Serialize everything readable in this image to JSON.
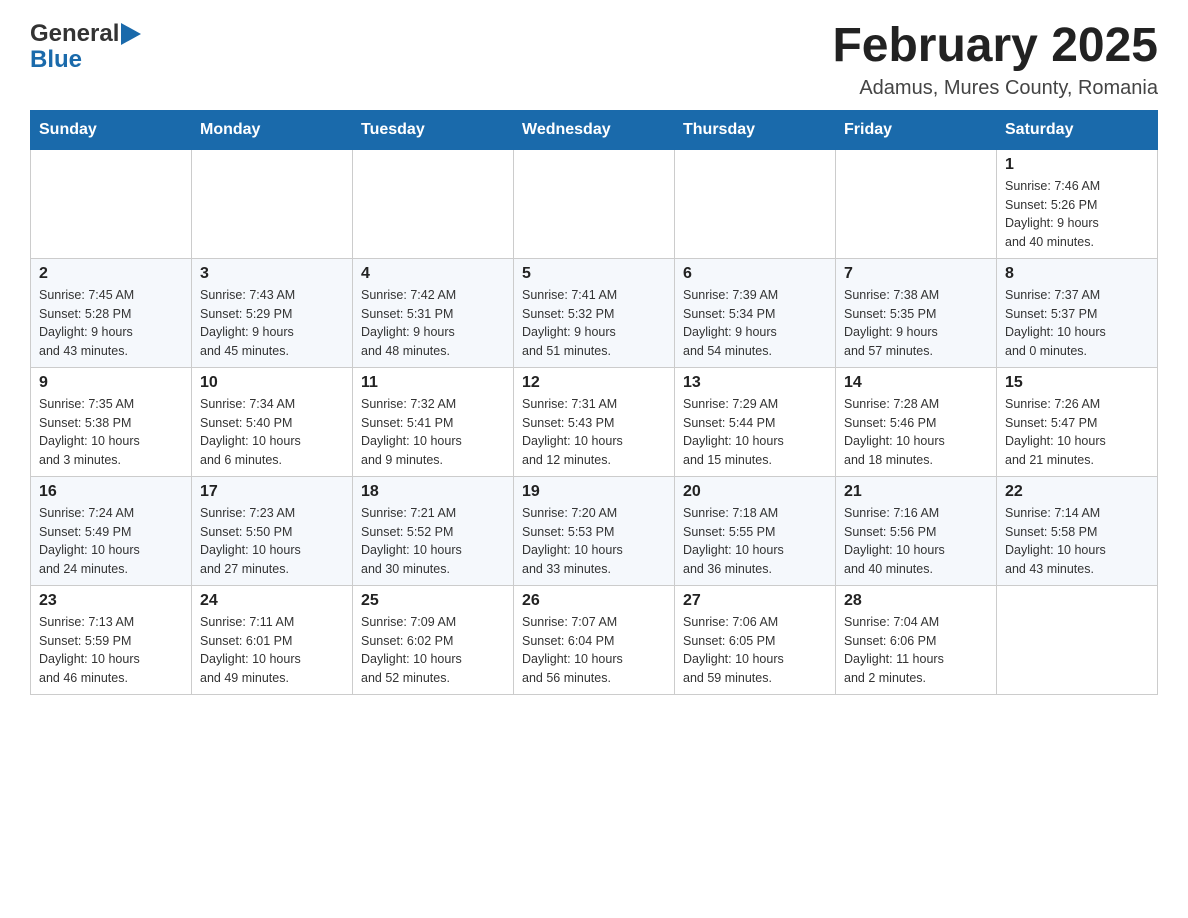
{
  "header": {
    "title": "February 2025",
    "subtitle": "Adamus, Mures County, Romania"
  },
  "logo": {
    "general": "General",
    "blue": "Blue"
  },
  "weekdays": [
    "Sunday",
    "Monday",
    "Tuesday",
    "Wednesday",
    "Thursday",
    "Friday",
    "Saturday"
  ],
  "weeks": [
    {
      "days": [
        {
          "number": "",
          "info": ""
        },
        {
          "number": "",
          "info": ""
        },
        {
          "number": "",
          "info": ""
        },
        {
          "number": "",
          "info": ""
        },
        {
          "number": "",
          "info": ""
        },
        {
          "number": "",
          "info": ""
        },
        {
          "number": "1",
          "info": "Sunrise: 7:46 AM\nSunset: 5:26 PM\nDaylight: 9 hours\nand 40 minutes."
        }
      ]
    },
    {
      "days": [
        {
          "number": "2",
          "info": "Sunrise: 7:45 AM\nSunset: 5:28 PM\nDaylight: 9 hours\nand 43 minutes."
        },
        {
          "number": "3",
          "info": "Sunrise: 7:43 AM\nSunset: 5:29 PM\nDaylight: 9 hours\nand 45 minutes."
        },
        {
          "number": "4",
          "info": "Sunrise: 7:42 AM\nSunset: 5:31 PM\nDaylight: 9 hours\nand 48 minutes."
        },
        {
          "number": "5",
          "info": "Sunrise: 7:41 AM\nSunset: 5:32 PM\nDaylight: 9 hours\nand 51 minutes."
        },
        {
          "number": "6",
          "info": "Sunrise: 7:39 AM\nSunset: 5:34 PM\nDaylight: 9 hours\nand 54 minutes."
        },
        {
          "number": "7",
          "info": "Sunrise: 7:38 AM\nSunset: 5:35 PM\nDaylight: 9 hours\nand 57 minutes."
        },
        {
          "number": "8",
          "info": "Sunrise: 7:37 AM\nSunset: 5:37 PM\nDaylight: 10 hours\nand 0 minutes."
        }
      ]
    },
    {
      "days": [
        {
          "number": "9",
          "info": "Sunrise: 7:35 AM\nSunset: 5:38 PM\nDaylight: 10 hours\nand 3 minutes."
        },
        {
          "number": "10",
          "info": "Sunrise: 7:34 AM\nSunset: 5:40 PM\nDaylight: 10 hours\nand 6 minutes."
        },
        {
          "number": "11",
          "info": "Sunrise: 7:32 AM\nSunset: 5:41 PM\nDaylight: 10 hours\nand 9 minutes."
        },
        {
          "number": "12",
          "info": "Sunrise: 7:31 AM\nSunset: 5:43 PM\nDaylight: 10 hours\nand 12 minutes."
        },
        {
          "number": "13",
          "info": "Sunrise: 7:29 AM\nSunset: 5:44 PM\nDaylight: 10 hours\nand 15 minutes."
        },
        {
          "number": "14",
          "info": "Sunrise: 7:28 AM\nSunset: 5:46 PM\nDaylight: 10 hours\nand 18 minutes."
        },
        {
          "number": "15",
          "info": "Sunrise: 7:26 AM\nSunset: 5:47 PM\nDaylight: 10 hours\nand 21 minutes."
        }
      ]
    },
    {
      "days": [
        {
          "number": "16",
          "info": "Sunrise: 7:24 AM\nSunset: 5:49 PM\nDaylight: 10 hours\nand 24 minutes."
        },
        {
          "number": "17",
          "info": "Sunrise: 7:23 AM\nSunset: 5:50 PM\nDaylight: 10 hours\nand 27 minutes."
        },
        {
          "number": "18",
          "info": "Sunrise: 7:21 AM\nSunset: 5:52 PM\nDaylight: 10 hours\nand 30 minutes."
        },
        {
          "number": "19",
          "info": "Sunrise: 7:20 AM\nSunset: 5:53 PM\nDaylight: 10 hours\nand 33 minutes."
        },
        {
          "number": "20",
          "info": "Sunrise: 7:18 AM\nSunset: 5:55 PM\nDaylight: 10 hours\nand 36 minutes."
        },
        {
          "number": "21",
          "info": "Sunrise: 7:16 AM\nSunset: 5:56 PM\nDaylight: 10 hours\nand 40 minutes."
        },
        {
          "number": "22",
          "info": "Sunrise: 7:14 AM\nSunset: 5:58 PM\nDaylight: 10 hours\nand 43 minutes."
        }
      ]
    },
    {
      "days": [
        {
          "number": "23",
          "info": "Sunrise: 7:13 AM\nSunset: 5:59 PM\nDaylight: 10 hours\nand 46 minutes."
        },
        {
          "number": "24",
          "info": "Sunrise: 7:11 AM\nSunset: 6:01 PM\nDaylight: 10 hours\nand 49 minutes."
        },
        {
          "number": "25",
          "info": "Sunrise: 7:09 AM\nSunset: 6:02 PM\nDaylight: 10 hours\nand 52 minutes."
        },
        {
          "number": "26",
          "info": "Sunrise: 7:07 AM\nSunset: 6:04 PM\nDaylight: 10 hours\nand 56 minutes."
        },
        {
          "number": "27",
          "info": "Sunrise: 7:06 AM\nSunset: 6:05 PM\nDaylight: 10 hours\nand 59 minutes."
        },
        {
          "number": "28",
          "info": "Sunrise: 7:04 AM\nSunset: 6:06 PM\nDaylight: 11 hours\nand 2 minutes."
        },
        {
          "number": "",
          "info": ""
        }
      ]
    }
  ]
}
